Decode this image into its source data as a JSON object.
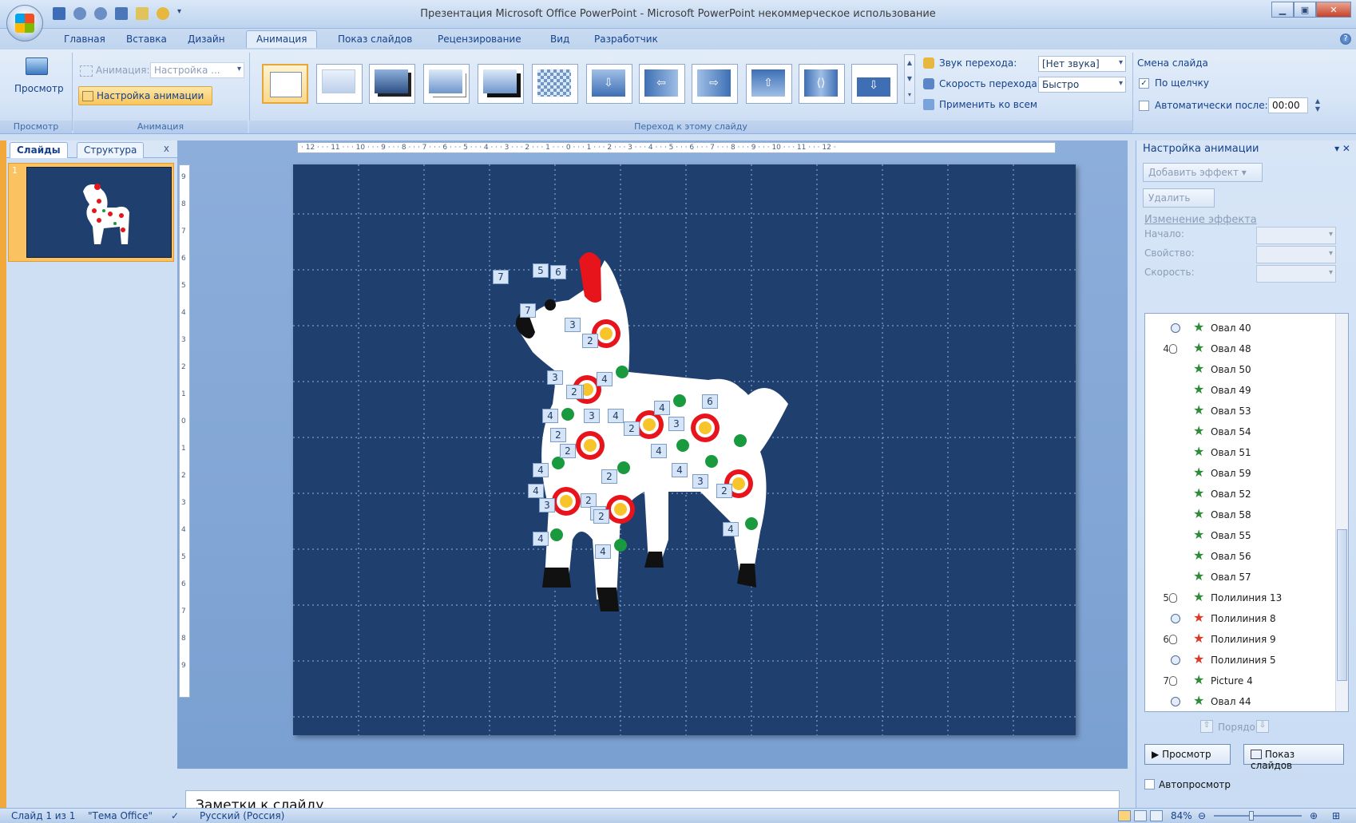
{
  "window": {
    "title": "Презентация Microsoft Office PowerPoint - Microsoft PowerPoint некоммерческое использование"
  },
  "tabs": [
    "Главная",
    "Вставка",
    "Дизайн",
    "Анимация",
    "Показ слайдов",
    "Рецензирование",
    "Вид",
    "Разработчик"
  ],
  "active_tab": "Анимация",
  "ribbon": {
    "preview_label": "Просмотр",
    "animation_label": "Анимация:",
    "animation_value": "Настройка ...",
    "custom_animation_btn": "Настройка анимации",
    "group_preview": "Просмотр",
    "group_animation": "Анимация",
    "group_transition": "Переход к этому слайду",
    "sound_label": "Звук перехода:",
    "sound_value": "[Нет звука]",
    "speed_label": "Скорость перехода:",
    "speed_value": "Быстро",
    "apply_all_label": "Применить ко всем",
    "advance_title": "Смена слайда",
    "on_click_label": "По щелчку",
    "on_click_checked": true,
    "auto_after_label": "Автоматически после:",
    "auto_after_value": "00:00",
    "auto_after_checked": false
  },
  "left_panel": {
    "tab_slides": "Слайды",
    "tab_outline": "Структура",
    "close": "x",
    "slide_number": "1"
  },
  "ruler": {
    "horizontal": "· 12 · · · 11 · · · 10 · · · 9 · · · 8 · · · 7 · · · 6 · · · 5 · · · 4 · · · 3 · · · 2 · · · 1 · · · 0 · · · 1 · · · 2 · · · 3 · · · 4 · · · 5 · · · 6 · · · 7 · · · 8 · · · 9 · · · 10 · · · 11 · · · 12 ·",
    "vertical": "9 8 7 6 5 4 3 2 1 0 1 2 3 4 5 6 7 8 9"
  },
  "slide_tags": [
    "7",
    "5",
    "6",
    "7",
    "3",
    "2",
    "3",
    "4",
    "2",
    "4",
    "4",
    "3",
    "4",
    "6",
    "2",
    "4",
    "3",
    "2",
    "2",
    "4",
    "4",
    "2",
    "4",
    "3",
    "2",
    "4",
    "3",
    "2",
    "3",
    "2",
    "4",
    "4",
    "4"
  ],
  "notes_placeholder": "Заметки к слайду",
  "task_pane": {
    "title": "Настройка анимации",
    "add_effect": "Добавить эффект",
    "remove": "Удалить",
    "modify_title": "Изменение эффекта",
    "start_label": "Начало:",
    "property_label": "Свойство:",
    "speed_label": "Скорость:",
    "order_label": "Порядок",
    "play_btn": "Просмотр",
    "slideshow_btn": "Показ слайдов",
    "autopreview_label": "Автопросмотр",
    "autopreview_checked": false,
    "list": [
      {
        "num": "",
        "trigger": "clock",
        "icon": "emphasis",
        "name": "Овал 40"
      },
      {
        "num": "4",
        "trigger": "mouse",
        "icon": "entrance",
        "name": "Овал 48"
      },
      {
        "num": "",
        "trigger": "",
        "icon": "entrance",
        "name": "Овал 50"
      },
      {
        "num": "",
        "trigger": "",
        "icon": "entrance",
        "name": "Овал 49"
      },
      {
        "num": "",
        "trigger": "",
        "icon": "entrance",
        "name": "Овал 53"
      },
      {
        "num": "",
        "trigger": "",
        "icon": "entrance",
        "name": "Овал 54"
      },
      {
        "num": "",
        "trigger": "",
        "icon": "entrance",
        "name": "Овал 51"
      },
      {
        "num": "",
        "trigger": "",
        "icon": "entrance",
        "name": "Овал 59"
      },
      {
        "num": "",
        "trigger": "",
        "icon": "entrance",
        "name": "Овал 52"
      },
      {
        "num": "",
        "trigger": "",
        "icon": "entrance",
        "name": "Овал 58"
      },
      {
        "num": "",
        "trigger": "",
        "icon": "entrance",
        "name": "Овал 55"
      },
      {
        "num": "",
        "trigger": "",
        "icon": "entrance",
        "name": "Овал 56"
      },
      {
        "num": "",
        "trigger": "",
        "icon": "entrance",
        "name": "Овал 57"
      },
      {
        "num": "5",
        "trigger": "mouse",
        "icon": "emphasis",
        "name": "Полилиния 13"
      },
      {
        "num": "",
        "trigger": "clock",
        "icon": "exit",
        "name": "Полилиния 8"
      },
      {
        "num": "6",
        "trigger": "mouse",
        "icon": "exit",
        "name": "Полилиния 9"
      },
      {
        "num": "",
        "trigger": "clock",
        "icon": "exit",
        "name": "Полилиния 5"
      },
      {
        "num": "7",
        "trigger": "mouse",
        "icon": "emphasis",
        "name": "Picture 4"
      },
      {
        "num": "",
        "trigger": "clock",
        "icon": "entrance",
        "name": "Овал 44"
      }
    ]
  },
  "status": {
    "slide_info": "Слайд 1 из 1",
    "theme": "\"Тема Office\"",
    "language": "Русский (Россия)",
    "zoom": "84%"
  },
  "colors": {
    "slide_bg": "#1f3f6e",
    "accent_orange": "#f1a93c",
    "dot_red": "#e8141b",
    "dot_yellow": "#f7c52b",
    "dot_green": "#1a9a3e",
    "dot_blue": "#1d6fc4"
  }
}
